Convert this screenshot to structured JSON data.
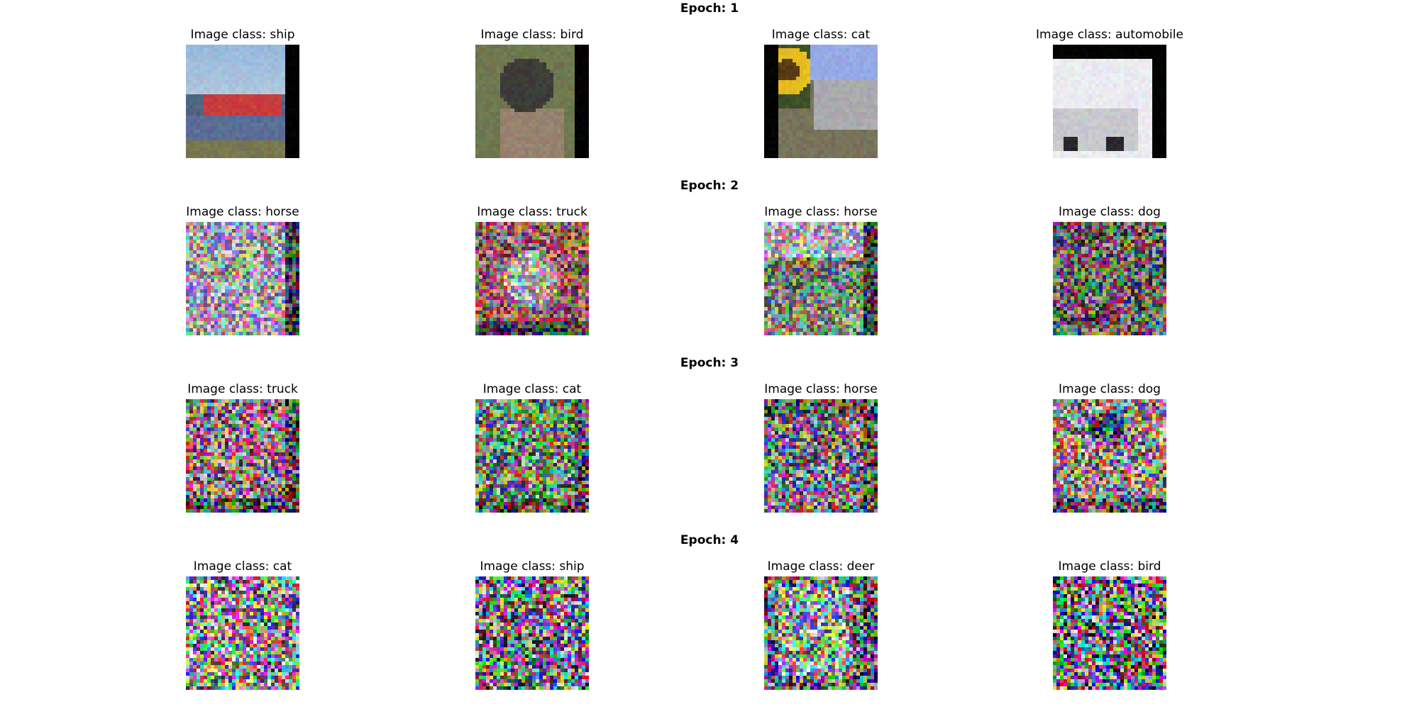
{
  "label_prefix": "Image class: ",
  "epochs": [
    {
      "title": "Epoch: 1",
      "images": [
        {
          "class": "ship",
          "noise": 0.0,
          "pad": "right",
          "scene": "ship"
        },
        {
          "class": "bird",
          "noise": 0.0,
          "pad": "right",
          "scene": "bird"
        },
        {
          "class": "cat",
          "noise": 0.0,
          "pad": "left",
          "scene": "cat"
        },
        {
          "class": "automobile",
          "noise": 0.0,
          "pad": "top-right",
          "scene": "car"
        }
      ]
    },
    {
      "title": "Epoch: 2",
      "images": [
        {
          "class": "horse",
          "noise": 0.55,
          "pad": "right",
          "scene": "bright"
        },
        {
          "class": "truck",
          "noise": 0.55,
          "pad": "bottom",
          "scene": "flower"
        },
        {
          "class": "horse",
          "noise": 0.55,
          "pad": "right",
          "scene": "field"
        },
        {
          "class": "dog",
          "noise": 0.6,
          "pad": "none",
          "scene": "dark"
        }
      ]
    },
    {
      "title": "Epoch: 3",
      "images": [
        {
          "class": "truck",
          "noise": 0.7,
          "pad": "bottom-right",
          "scene": "pink"
        },
        {
          "class": "cat",
          "noise": 0.7,
          "pad": "bottom-right",
          "scene": "green"
        },
        {
          "class": "horse",
          "noise": 0.7,
          "pad": "top-right",
          "scene": "mixed"
        },
        {
          "class": "dog",
          "noise": 0.7,
          "pad": "bottom",
          "scene": "dogface"
        }
      ]
    },
    {
      "title": "Epoch: 4",
      "images": [
        {
          "class": "cat",
          "noise": 0.8,
          "pad": "none",
          "scene": "bright"
        },
        {
          "class": "ship",
          "noise": 0.8,
          "pad": "none",
          "scene": "mixed"
        },
        {
          "class": "deer",
          "noise": 0.75,
          "pad": "right",
          "scene": "whitebox"
        },
        {
          "class": "bird",
          "noise": 0.85,
          "pad": "none",
          "scene": "dark"
        }
      ]
    }
  ]
}
